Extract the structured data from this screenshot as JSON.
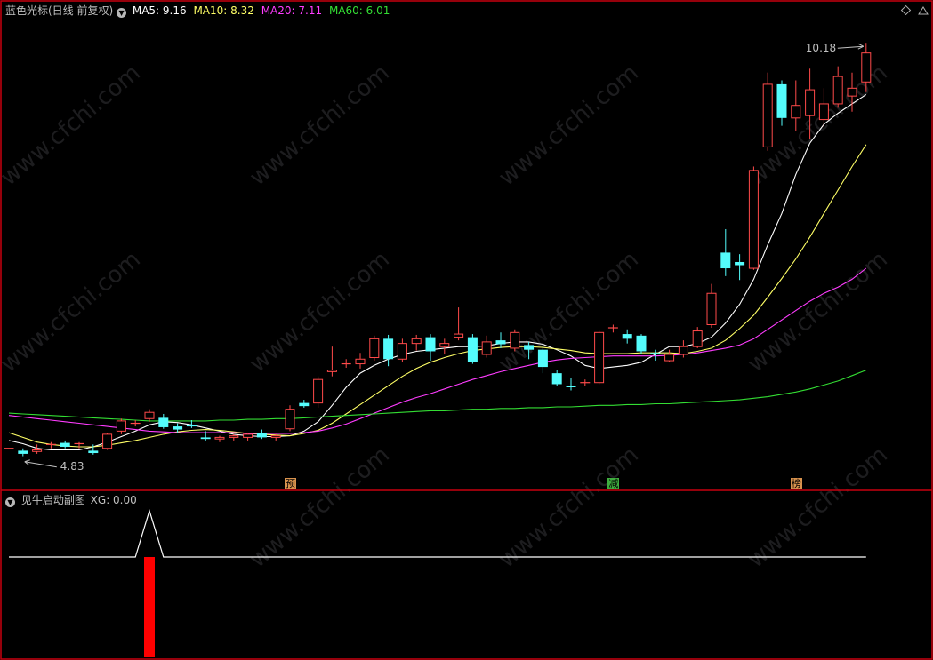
{
  "main_header": {
    "title": "蓝色光标(日线 前复权)",
    "ma5_label": "MA5: 9.16",
    "ma10_label": "MA10: 8.32",
    "ma20_label": "MA20: 7.11",
    "ma60_label": "MA60: 6.01"
  },
  "sub_header": {
    "title": "见牛启动副图",
    "xg_label": "XG: 0.00"
  },
  "markers": [
    {
      "text": "预",
      "bar": 20,
      "color": "#d9934e"
    },
    {
      "text": "减",
      "bar": 43,
      "color": "#3fae3f"
    },
    {
      "text": "榜",
      "bar": 56,
      "color": "#d9934e"
    }
  ],
  "watermark": "www.cfchi.com",
  "colors": {
    "frame": "#c8000f",
    "up": "#ff4a4a",
    "down": "#54fcfc",
    "ma5": "#ffffff",
    "ma10": "#ffff66",
    "ma20": "#ff3cff",
    "ma60": "#33dd33",
    "price_label": "#c0c0c0",
    "xg_line": "#ffffff",
    "xg_bar": "#ff0000"
  },
  "chart_data": [
    {
      "type": "candlestick",
      "title": "蓝色光标(日线 前复权)",
      "annotations": [
        {
          "text": "10.18",
          "bar": 61,
          "value": 10.18,
          "kind": "high"
        },
        {
          "text": "4.83",
          "bar": 1,
          "value": 4.83,
          "kind": "low"
        }
      ],
      "ylim": [
        4.6,
        10.5
      ],
      "ohlc": [
        [
          5.0,
          5.0,
          5.0,
          5.0
        ],
        [
          4.97,
          5.0,
          4.9,
          4.93
        ],
        [
          4.96,
          5.05,
          4.93,
          4.98
        ],
        [
          5.04,
          5.08,
          5.0,
          5.05
        ],
        [
          5.07,
          5.1,
          5.0,
          5.02
        ],
        [
          5.06,
          5.08,
          5.0,
          5.06
        ],
        [
          4.97,
          5.05,
          4.92,
          4.94
        ],
        [
          5.0,
          5.2,
          4.98,
          5.18
        ],
        [
          5.22,
          5.38,
          5.18,
          5.35
        ],
        [
          5.32,
          5.36,
          5.28,
          5.32
        ],
        [
          5.38,
          5.5,
          5.34,
          5.46
        ],
        [
          5.39,
          5.44,
          5.25,
          5.27
        ],
        [
          5.28,
          5.32,
          5.2,
          5.24
        ],
        [
          5.3,
          5.36,
          5.26,
          5.28
        ],
        [
          5.14,
          5.22,
          5.1,
          5.12
        ],
        [
          5.12,
          5.16,
          5.08,
          5.14
        ],
        [
          5.14,
          5.18,
          5.1,
          5.16
        ],
        [
          5.14,
          5.2,
          5.1,
          5.18
        ],
        [
          5.2,
          5.24,
          5.12,
          5.14
        ],
        [
          5.14,
          5.18,
          5.1,
          5.16
        ],
        [
          5.25,
          5.55,
          5.22,
          5.5
        ],
        [
          5.58,
          5.62,
          5.52,
          5.54
        ],
        [
          5.58,
          5.92,
          5.52,
          5.88
        ],
        [
          5.98,
          6.3,
          5.92,
          6.0
        ],
        [
          6.08,
          6.14,
          6.03,
          6.08
        ],
        [
          6.08,
          6.22,
          6.02,
          6.14
        ],
        [
          6.16,
          6.44,
          6.12,
          6.4
        ],
        [
          6.4,
          6.45,
          6.05,
          6.14
        ],
        [
          6.14,
          6.4,
          6.1,
          6.34
        ],
        [
          6.34,
          6.45,
          6.25,
          6.4
        ],
        [
          6.42,
          6.46,
          6.12,
          6.24
        ],
        [
          6.3,
          6.4,
          6.2,
          6.34
        ],
        [
          6.42,
          6.8,
          6.38,
          6.46
        ],
        [
          6.42,
          6.46,
          6.08,
          6.1
        ],
        [
          6.2,
          6.44,
          6.16,
          6.36
        ],
        [
          6.38,
          6.48,
          6.28,
          6.33
        ],
        [
          6.28,
          6.52,
          6.24,
          6.48
        ],
        [
          6.32,
          6.36,
          6.14,
          6.26
        ],
        [
          6.26,
          6.32,
          5.96,
          6.04
        ],
        [
          5.96,
          6.0,
          5.8,
          5.82
        ],
        [
          5.8,
          5.9,
          5.74,
          5.78
        ],
        [
          5.84,
          5.88,
          5.8,
          5.84
        ],
        [
          5.84,
          6.5,
          5.82,
          6.48
        ],
        [
          6.54,
          6.58,
          6.48,
          6.54
        ],
        [
          6.46,
          6.52,
          6.34,
          6.4
        ],
        [
          6.44,
          6.46,
          6.2,
          6.24
        ],
        [
          6.22,
          6.26,
          6.12,
          6.2
        ],
        [
          6.12,
          6.26,
          6.1,
          6.2
        ],
        [
          6.2,
          6.38,
          6.16,
          6.3
        ],
        [
          6.3,
          6.55,
          6.28,
          6.5
        ],
        [
          6.58,
          7.1,
          6.54,
          6.98
        ],
        [
          7.5,
          7.8,
          7.2,
          7.3
        ],
        [
          7.38,
          7.48,
          7.15,
          7.34
        ],
        [
          7.3,
          8.6,
          7.28,
          8.55
        ],
        [
          8.85,
          9.8,
          8.8,
          9.65
        ],
        [
          9.65,
          9.7,
          9.12,
          9.22
        ],
        [
          9.22,
          9.7,
          9.05,
          9.38
        ],
        [
          9.25,
          9.85,
          8.95,
          9.58
        ],
        [
          9.2,
          9.6,
          9.1,
          9.4
        ],
        [
          9.4,
          9.88,
          9.35,
          9.75
        ],
        [
          9.5,
          9.8,
          9.3,
          9.6
        ],
        [
          9.68,
          10.18,
          9.55,
          10.05
        ]
      ],
      "ma": {
        "MA5": {
          "start": 0,
          "values": [
            5.1,
            5.06,
            5.0,
            4.98,
            4.98,
            4.98,
            5.02,
            5.08,
            5.15,
            5.22,
            5.3,
            5.34,
            5.33,
            5.3,
            5.26,
            5.22,
            5.18,
            5.16,
            5.15,
            5.15,
            5.16,
            5.22,
            5.34,
            5.55,
            5.78,
            5.96,
            6.06,
            6.14,
            6.2,
            6.24,
            6.26,
            6.28,
            6.3,
            6.3,
            6.31,
            6.34,
            6.36,
            6.36,
            6.33,
            6.26,
            6.18,
            6.06,
            6.02,
            6.04,
            6.06,
            6.1,
            6.2,
            6.3,
            6.3,
            6.34,
            6.42,
            6.6,
            6.84,
            7.16,
            7.6,
            8.0,
            8.5,
            8.9,
            9.14,
            9.28,
            9.4,
            9.52
          ]
        },
        "MA10": {
          "start": 0,
          "values": [
            5.2,
            5.14,
            5.08,
            5.05,
            5.03,
            5.02,
            5.02,
            5.04,
            5.07,
            5.1,
            5.14,
            5.18,
            5.21,
            5.23,
            5.24,
            5.23,
            5.21,
            5.19,
            5.18,
            5.17,
            5.16,
            5.19,
            5.23,
            5.32,
            5.44,
            5.56,
            5.68,
            5.8,
            5.92,
            6.02,
            6.1,
            6.16,
            6.21,
            6.25,
            6.27,
            6.29,
            6.3,
            6.3,
            6.29,
            6.27,
            6.25,
            6.22,
            6.21,
            6.21,
            6.21,
            6.22,
            6.22,
            6.22,
            6.21,
            6.24,
            6.28,
            6.38,
            6.53,
            6.7,
            6.93,
            7.17,
            7.42,
            7.7,
            8.0,
            8.3,
            8.6,
            8.88
          ]
        },
        "MA20": {
          "start": 0,
          "values": [
            5.42,
            5.4,
            5.38,
            5.36,
            5.34,
            5.32,
            5.3,
            5.28,
            5.26,
            5.24,
            5.22,
            5.21,
            5.2,
            5.2,
            5.2,
            5.2,
            5.2,
            5.19,
            5.19,
            5.19,
            5.19,
            5.2,
            5.22,
            5.26,
            5.31,
            5.38,
            5.45,
            5.52,
            5.59,
            5.65,
            5.7,
            5.76,
            5.82,
            5.88,
            5.93,
            5.98,
            6.02,
            6.06,
            6.1,
            6.13,
            6.15,
            6.16,
            6.17,
            6.18,
            6.18,
            6.18,
            6.18,
            6.19,
            6.2,
            6.22,
            6.25,
            6.28,
            6.32,
            6.4,
            6.52,
            6.64,
            6.76,
            6.88,
            6.98,
            7.06,
            7.16,
            7.3
          ]
        },
        "MA60": {
          "start": 0,
          "values": [
            5.45,
            5.44,
            5.43,
            5.42,
            5.41,
            5.4,
            5.39,
            5.38,
            5.37,
            5.36,
            5.35,
            5.35,
            5.35,
            5.35,
            5.35,
            5.36,
            5.36,
            5.37,
            5.37,
            5.38,
            5.38,
            5.39,
            5.4,
            5.41,
            5.42,
            5.43,
            5.44,
            5.45,
            5.46,
            5.47,
            5.48,
            5.48,
            5.49,
            5.5,
            5.5,
            5.51,
            5.51,
            5.52,
            5.52,
            5.53,
            5.53,
            5.54,
            5.55,
            5.55,
            5.56,
            5.56,
            5.57,
            5.57,
            5.58,
            5.59,
            5.6,
            5.61,
            5.62,
            5.64,
            5.66,
            5.69,
            5.72,
            5.76,
            5.81,
            5.86,
            5.93,
            6.0
          ]
        }
      }
    },
    {
      "type": "line",
      "title": "见牛启动副图",
      "series": [
        {
          "name": "XG",
          "values": [
            0,
            0,
            0,
            0,
            0,
            0,
            0,
            0,
            0,
            0,
            1,
            0,
            0,
            0,
            0,
            0,
            0,
            0,
            0,
            0,
            0,
            0,
            0,
            0,
            0,
            0,
            0,
            0,
            0,
            0,
            0,
            0,
            0,
            0,
            0,
            0,
            0,
            0,
            0,
            0,
            0,
            0,
            0,
            0,
            0,
            0,
            0,
            0,
            0,
            0,
            0,
            0,
            0,
            0,
            0,
            0,
            0,
            0,
            0,
            0,
            0,
            0
          ]
        }
      ],
      "ylim": [
        0,
        1
      ]
    }
  ]
}
